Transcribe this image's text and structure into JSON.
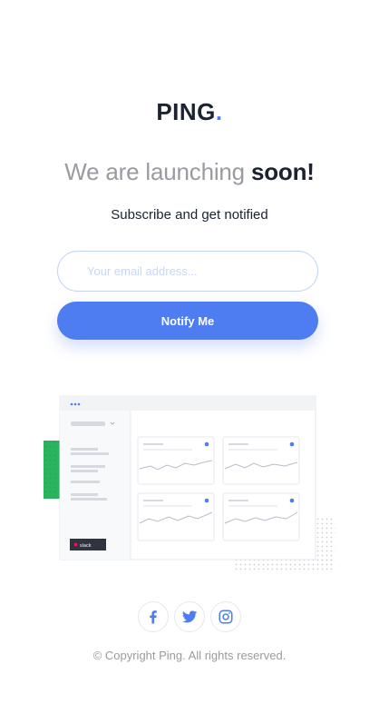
{
  "brand": {
    "name": "PING",
    "dot": ".",
    "accent_color": "#4e7df1"
  },
  "hero": {
    "headline_regular": "We are launching",
    "headline_bold": "soon!",
    "subtitle": "Subscribe and get notified"
  },
  "form": {
    "email_placeholder": "Your email address...",
    "email_value": "",
    "submit_label": "Notify Me"
  },
  "illustration": {
    "slack_badge": "slack"
  },
  "social": [
    {
      "name": "facebook",
      "icon": "facebook-icon"
    },
    {
      "name": "twitter",
      "icon": "twitter-icon"
    },
    {
      "name": "instagram",
      "icon": "instagram-icon"
    }
  ],
  "footer": {
    "copyright": "© Copyright Ping. All rights reserved."
  }
}
